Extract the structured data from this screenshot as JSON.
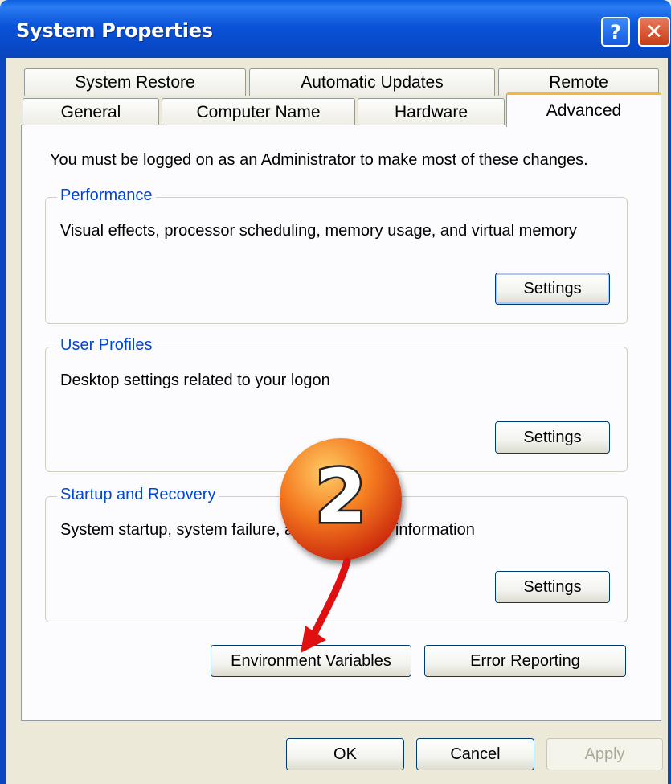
{
  "window": {
    "title": "System Properties",
    "help_label": "?",
    "close_label": "✕"
  },
  "tabs_row1": [
    "System Restore",
    "Automatic Updates",
    "Remote"
  ],
  "tabs_row2": [
    "General",
    "Computer Name",
    "Hardware",
    "Advanced"
  ],
  "active_tab": "Advanced",
  "admin_note": "You must be logged on as an Administrator to make most of these changes.",
  "groups": [
    {
      "title": "Performance",
      "description": "Visual effects, processor scheduling, memory usage, and virtual memory",
      "button": "Settings"
    },
    {
      "title": "User Profiles",
      "description": "Desktop settings related to your logon",
      "button": "Settings"
    },
    {
      "title": "Startup and Recovery",
      "description": "System startup, system failure, and debugging information",
      "button": "Settings"
    }
  ],
  "buttons": {
    "env_vars": "Environment Variables",
    "error_reporting": "Error Reporting",
    "ok": "OK",
    "cancel": "Cancel",
    "apply": "Apply"
  },
  "callout": {
    "number": "2"
  },
  "colors": {
    "title_bar": "#0a52d8",
    "group_title": "#0046d5",
    "active_tab_accent": "#f7b53c",
    "callout": "#f47a20"
  }
}
